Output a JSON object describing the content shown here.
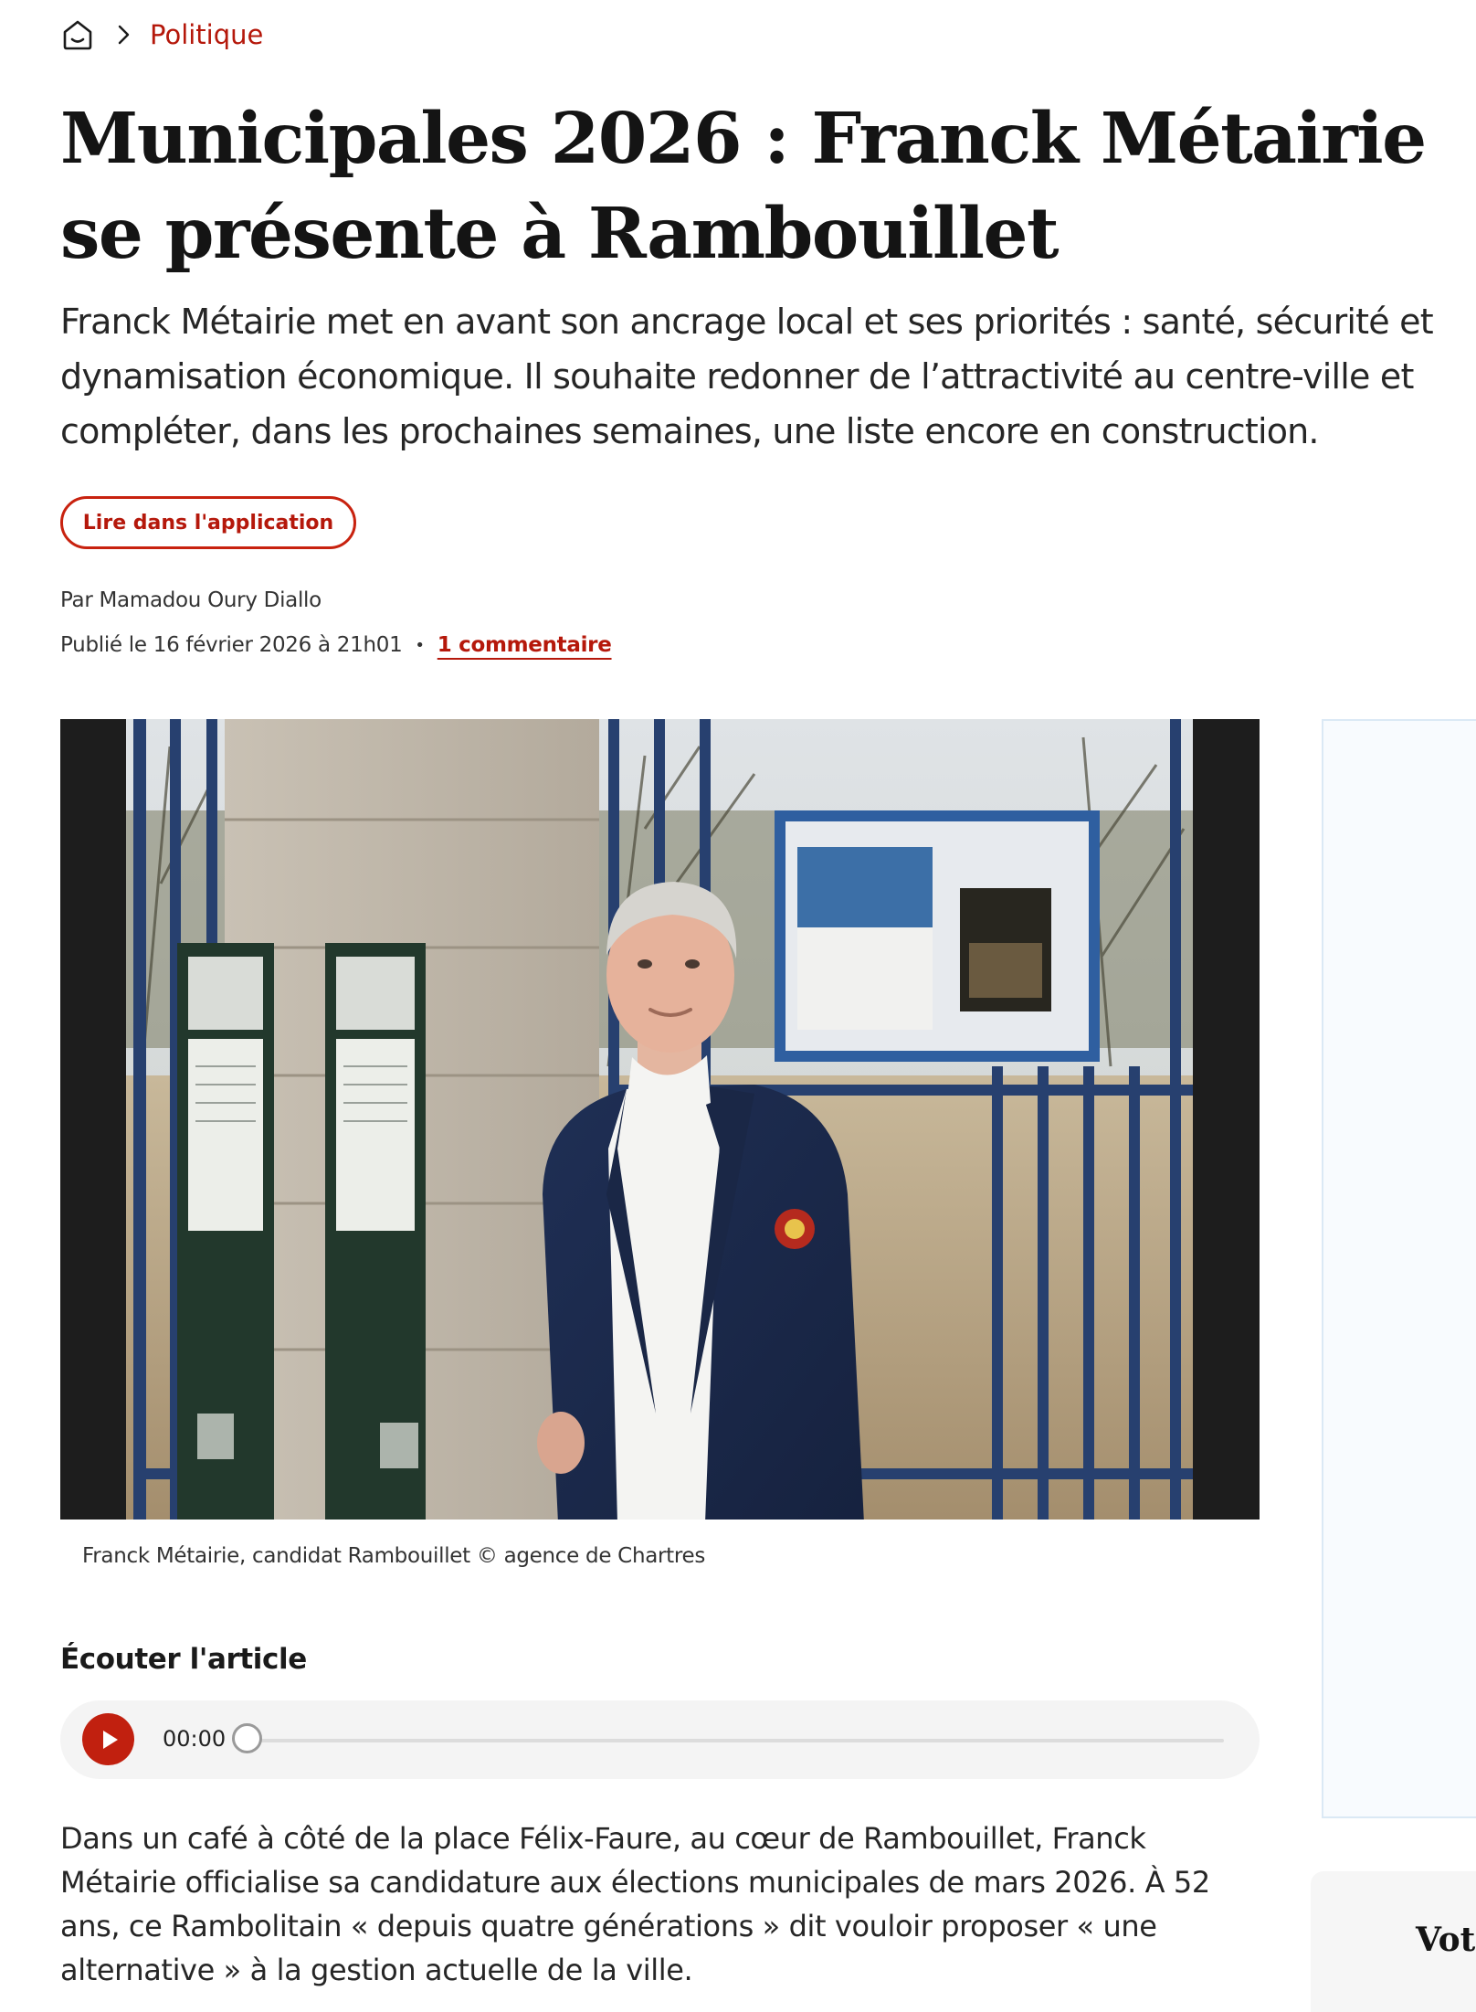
{
  "breadcrumb": {
    "home_icon": "home-icon",
    "separator_icon": "chevron-right-icon",
    "section": "Politique"
  },
  "article": {
    "title": "Municipales 2026 : Franck Métairie se présente à Rambouillet",
    "chapo": "Franck Métairie met en avant son ancrage local et ses priorités : santé, sécurité et dynamisation économique. Il souhaite redonner de l’attractivité au centre-ville et compléter, dans les prochaines semaines, une liste encore en construction.",
    "app_button_label": "Lire dans l'application",
    "author": "Par Mamadou Oury Diallo",
    "published": "Publié le 16 février 2026 à 21h01",
    "meta_separator": "•",
    "comments_link": "1 commentaire",
    "photo_caption": "Franck Métairie, candidat Rambouillet © agence de Chartres",
    "photo_alt": "Franck Métairie, candidat Rambouillet",
    "body_paragraph": "Dans un café à côté de la place Félix-Faure, au cœur de Rambouillet, Franck Métairie officialise sa candidature aux élections municipales de mars 2026. À 52 ans, ce Rambolitain « depuis quatre générations » dit vouloir proposer « une alternative » à la gestion actuelle de la ville."
  },
  "audio_player": {
    "heading": "Écouter l'article",
    "play_icon": "play-icon",
    "current_time": "00:00",
    "progress": 0
  },
  "sidebar": {
    "card_title": "Vot"
  },
  "colors": {
    "accent": "#b5180b",
    "play_button": "#c1200f",
    "text": "#1a1a1a",
    "sidebar_border": "#dbe9f5"
  }
}
